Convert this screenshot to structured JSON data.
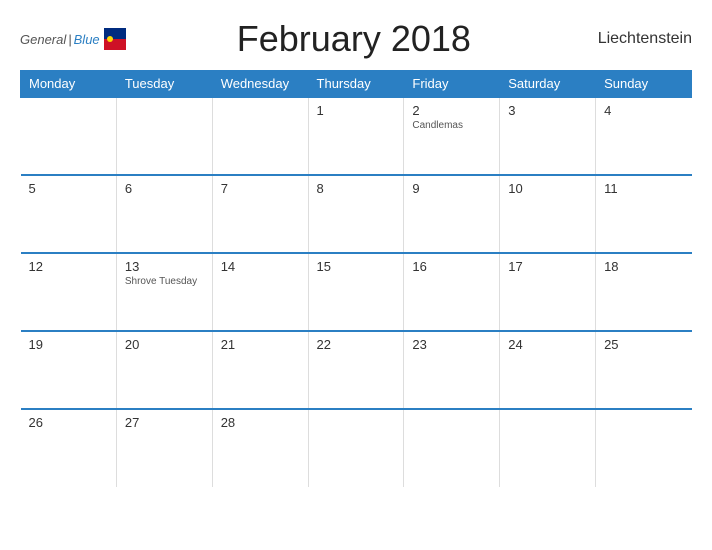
{
  "header": {
    "title": "February 2018",
    "country": "Liechtenstein",
    "logo_general": "General",
    "logo_blue": "Blue"
  },
  "calendar": {
    "days_of_week": [
      "Monday",
      "Tuesday",
      "Wednesday",
      "Thursday",
      "Friday",
      "Saturday",
      "Sunday"
    ],
    "weeks": [
      [
        {
          "day": "",
          "event": "",
          "empty": true
        },
        {
          "day": "",
          "event": "",
          "empty": true
        },
        {
          "day": "",
          "event": "",
          "empty": true
        },
        {
          "day": "1",
          "event": ""
        },
        {
          "day": "2",
          "event": "Candlemas"
        },
        {
          "day": "3",
          "event": ""
        },
        {
          "day": "4",
          "event": ""
        }
      ],
      [
        {
          "day": "5",
          "event": ""
        },
        {
          "day": "6",
          "event": ""
        },
        {
          "day": "7",
          "event": ""
        },
        {
          "day": "8",
          "event": ""
        },
        {
          "day": "9",
          "event": ""
        },
        {
          "day": "10",
          "event": ""
        },
        {
          "day": "11",
          "event": ""
        }
      ],
      [
        {
          "day": "12",
          "event": ""
        },
        {
          "day": "13",
          "event": "Shrove Tuesday"
        },
        {
          "day": "14",
          "event": ""
        },
        {
          "day": "15",
          "event": ""
        },
        {
          "day": "16",
          "event": ""
        },
        {
          "day": "17",
          "event": ""
        },
        {
          "day": "18",
          "event": ""
        }
      ],
      [
        {
          "day": "19",
          "event": ""
        },
        {
          "day": "20",
          "event": ""
        },
        {
          "day": "21",
          "event": ""
        },
        {
          "day": "22",
          "event": ""
        },
        {
          "day": "23",
          "event": ""
        },
        {
          "day": "24",
          "event": ""
        },
        {
          "day": "25",
          "event": ""
        }
      ],
      [
        {
          "day": "26",
          "event": ""
        },
        {
          "day": "27",
          "event": ""
        },
        {
          "day": "28",
          "event": ""
        },
        {
          "day": "",
          "event": "",
          "empty": true
        },
        {
          "day": "",
          "event": "",
          "empty": true
        },
        {
          "day": "",
          "event": "",
          "empty": true
        },
        {
          "day": "",
          "event": "",
          "empty": true
        }
      ]
    ]
  }
}
